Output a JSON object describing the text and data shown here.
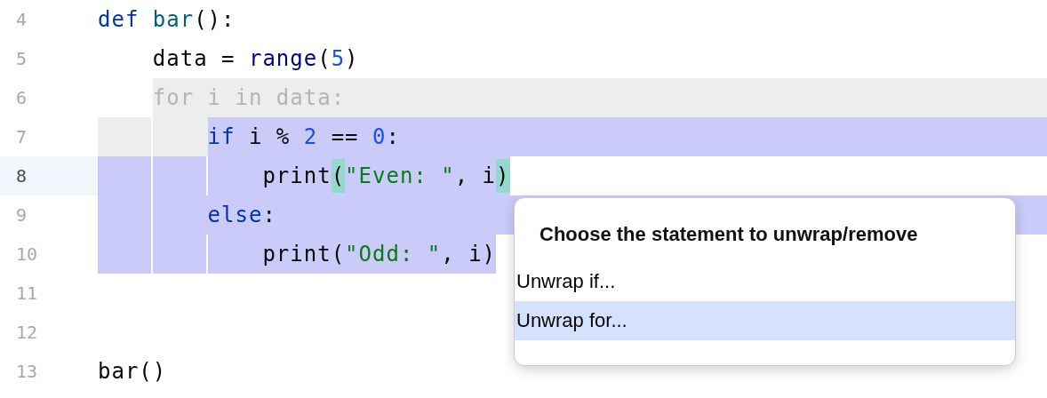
{
  "editor": {
    "lines": [
      {
        "number": "4",
        "current": false,
        "removed": false,
        "selected": false,
        "tokens": [
          {
            "kind": "keyword",
            "text": "def"
          },
          {
            "kind": "function-name",
            "text": " bar"
          },
          {
            "kind": "plain",
            "text": "():"
          }
        ]
      },
      {
        "number": "5",
        "current": false,
        "removed": false,
        "selected": false,
        "tokens": [
          {
            "kind": "plain",
            "text": "    data = "
          },
          {
            "kind": "builtin",
            "text": "range"
          },
          {
            "kind": "plain",
            "text": "("
          },
          {
            "kind": "number",
            "text": "5"
          },
          {
            "kind": "plain",
            "text": ")"
          }
        ]
      },
      {
        "number": "6",
        "current": false,
        "removed": true,
        "selected": false,
        "tokens": [
          {
            "kind": "plain",
            "text": "    for i in data:"
          }
        ]
      },
      {
        "number": "7",
        "current": false,
        "removed": false,
        "selected": true,
        "full_width": true,
        "tokens": [
          {
            "kind": "keyword",
            "text": "        if"
          },
          {
            "kind": "plain",
            "text": " i % "
          },
          {
            "kind": "number",
            "text": "2"
          },
          {
            "kind": "plain",
            "text": " == "
          },
          {
            "kind": "number",
            "text": "0"
          },
          {
            "kind": "plain",
            "text": ":"
          }
        ]
      },
      {
        "number": "8",
        "current": true,
        "removed": false,
        "selected": true,
        "full_width": false,
        "tokens": [
          {
            "kind": "plain",
            "text": "            print"
          },
          {
            "kind": "brace-match",
            "text": "("
          },
          {
            "kind": "string",
            "text": "\"Even: \""
          },
          {
            "kind": "plain",
            "text": ", i"
          },
          {
            "kind": "brace-match",
            "text": ")"
          }
        ]
      },
      {
        "number": "9",
        "current": false,
        "removed": false,
        "selected": true,
        "full_width": true,
        "tokens": [
          {
            "kind": "keyword",
            "text": "        else"
          },
          {
            "kind": "plain",
            "text": ":"
          }
        ]
      },
      {
        "number": "10",
        "current": false,
        "removed": false,
        "selected": true,
        "full_width": false,
        "tokens": [
          {
            "kind": "plain",
            "text": "            print("
          },
          {
            "kind": "string",
            "text": "\"Odd: \""
          },
          {
            "kind": "plain",
            "text": ", i)"
          }
        ]
      },
      {
        "number": "11",
        "current": false,
        "removed": false,
        "selected": false
      },
      {
        "number": "12",
        "current": false,
        "removed": false,
        "selected": false
      },
      {
        "number": "13",
        "current": false,
        "removed": false,
        "selected": false,
        "tokens": [
          {
            "kind": "plain",
            "text": "bar()"
          }
        ]
      }
    ]
  },
  "popup": {
    "title": "Choose the statement to unwrap/remove",
    "items": [
      {
        "label": "Unwrap if...",
        "selected": false
      },
      {
        "label": "Unwrap for...",
        "selected": true
      }
    ]
  }
}
